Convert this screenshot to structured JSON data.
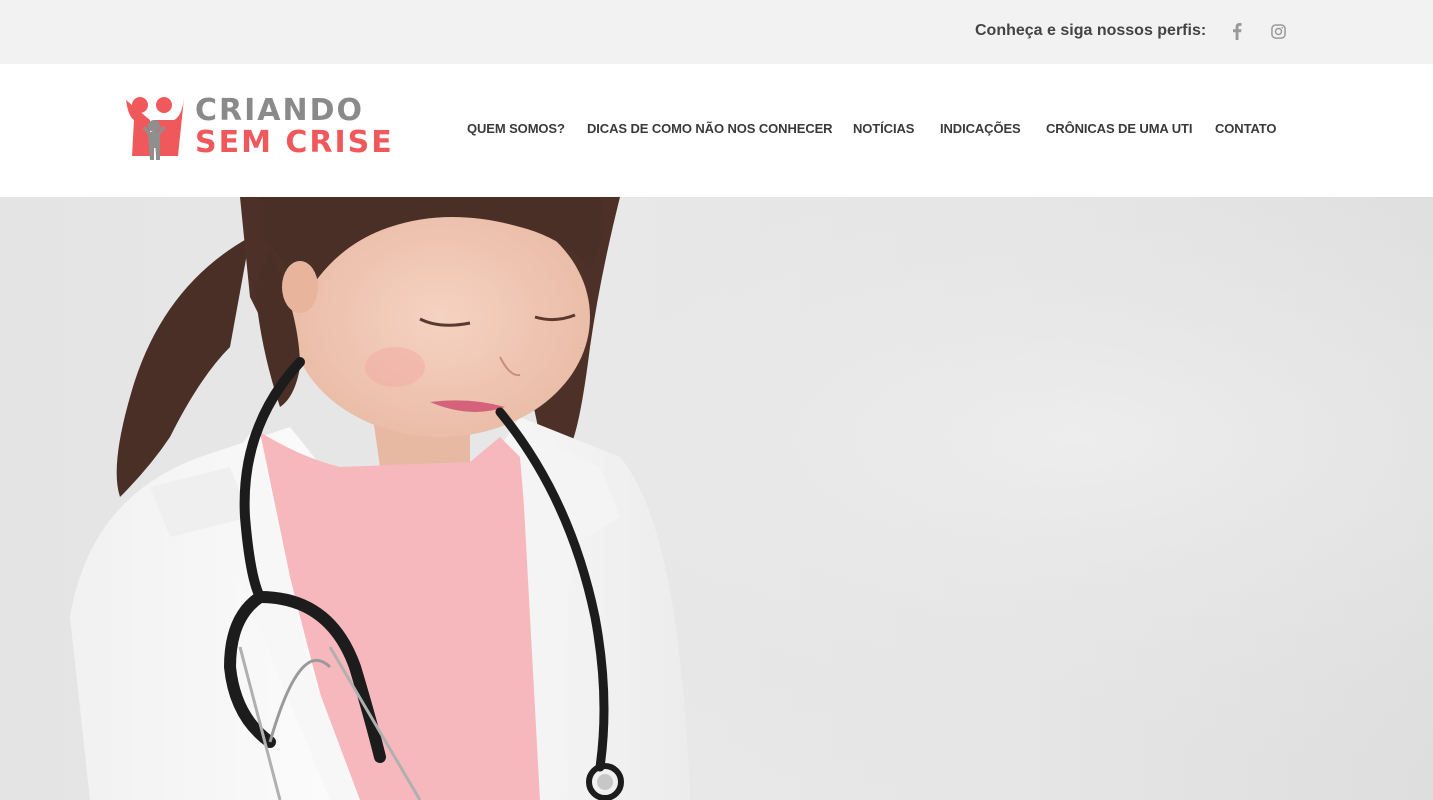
{
  "topbar": {
    "follow_text": "Conheça e siga nossos perfis:",
    "social": [
      {
        "name": "facebook",
        "icon": "facebook-icon"
      },
      {
        "name": "instagram",
        "icon": "instagram-icon"
      }
    ]
  },
  "logo": {
    "line1": "CRIANDO",
    "line2": "SEM CRISE",
    "colors": {
      "line1": "#8a8a8a",
      "line2": "#f0595c",
      "mark": "#f0595c",
      "figure": "#8f8f8f"
    }
  },
  "nav": {
    "items": [
      "QUEM SOMOS?",
      "DICAS DE COMO NÃO NOS CONHECER",
      "NOTÍCIAS",
      "INDICAÇÕES",
      "CRÔNICAS DE UMA UTI",
      "CONTATO"
    ]
  },
  "hero": {
    "image": "girl-doctor-photo",
    "colors": {
      "background": "#e6e6e6",
      "coat": "#fbfbfb",
      "shirt": "#f6b8bd",
      "hair": "#4a2f27",
      "skin": "#f1c9b6",
      "stethoscope": "#1c1c1c"
    }
  }
}
